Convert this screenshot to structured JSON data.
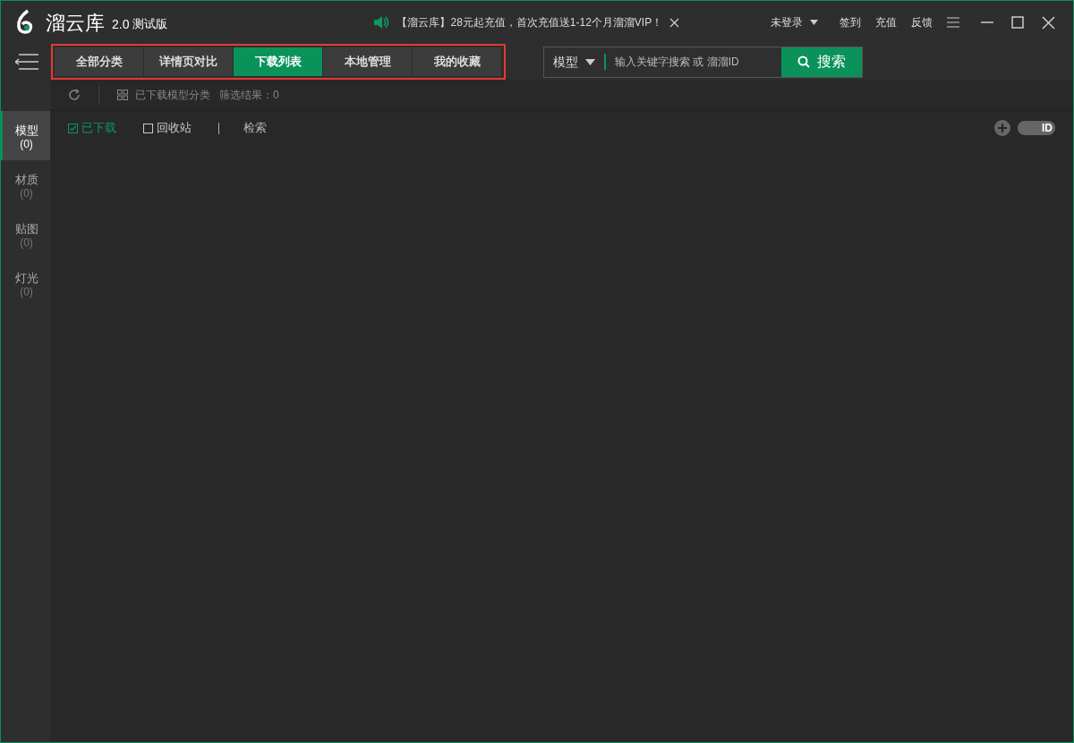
{
  "app": {
    "name": "溜云库",
    "version": "2.0",
    "edition": "测试版"
  },
  "notice": {
    "text": "【溜云库】28元起充值，首次充值送1-12个月溜溜VIP！"
  },
  "header_links": {
    "account": "未登录",
    "items": [
      "签到",
      "充值",
      "反馈"
    ]
  },
  "tabs": [
    {
      "label": "全部分类",
      "selected": false
    },
    {
      "label": "详情页对比",
      "selected": false
    },
    {
      "label": "下载列表",
      "selected": true
    },
    {
      "label": "本地管理",
      "selected": false
    },
    {
      "label": "我的收藏",
      "selected": false
    }
  ],
  "search": {
    "scope": "模型",
    "placeholder": "输入关键字搜索 或 溜溜ID",
    "button": "搜索"
  },
  "toolbar": {
    "category": "已下载模型分类",
    "result": "筛选结果：0"
  },
  "sidebar": {
    "items": [
      {
        "label": "模型",
        "count": "(0)",
        "selected": true
      },
      {
        "label": "材质",
        "count": "(0)",
        "selected": false
      },
      {
        "label": "贴图",
        "count": "(0)",
        "selected": false
      },
      {
        "label": "灯光",
        "count": "(0)",
        "selected": false
      }
    ]
  },
  "filters": [
    {
      "label": "已下载",
      "checked": true
    },
    {
      "label": "回收站",
      "checked": false
    }
  ],
  "filter_search": "检索",
  "id_toggle": {
    "label": "ID",
    "on": true
  }
}
